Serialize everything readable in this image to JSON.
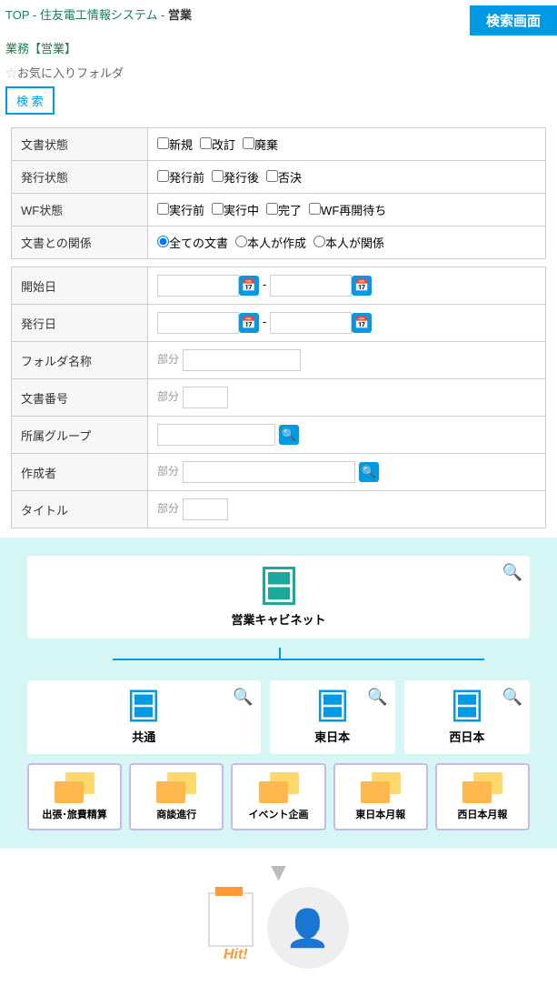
{
  "breadcrumb": {
    "top": "TOP",
    "sys": "住友電工情報システム",
    "sect": "営業"
  },
  "badge": "検索画面",
  "sub": "業務【営業】",
  "fav": "お気に入りフォルダ",
  "search_btn": "検 索",
  "t1": {
    "r1": {
      "l": "文書状態",
      "o": [
        "新規",
        "改訂",
        "廃棄"
      ]
    },
    "r2": {
      "l": "発行状態",
      "o": [
        "発行前",
        "発行後",
        "否決"
      ]
    },
    "r3": {
      "l": "WF状態",
      "o": [
        "実行前",
        "実行中",
        "完了",
        "WF再開待ち"
      ]
    },
    "r4": {
      "l": "文書との関係",
      "o": [
        "全ての文書",
        "本人が作成",
        "本人が関係"
      ]
    }
  },
  "t2": {
    "start": "開始日",
    "issue": "発行日",
    "folder": "フォルダ名称",
    "docno": "文書番号",
    "group": "所属グループ",
    "author": "作成者",
    "title": "タイトル",
    "partial": "部分"
  },
  "dg": {
    "root": "営業キャビネット",
    "cabs": [
      "共通",
      "東日本",
      "西日本"
    ],
    "folds": [
      "出張･旅費精算",
      "商談進行",
      "イベント企画",
      "東日本月報",
      "西日本月報"
    ]
  },
  "hit": "Hit!"
}
